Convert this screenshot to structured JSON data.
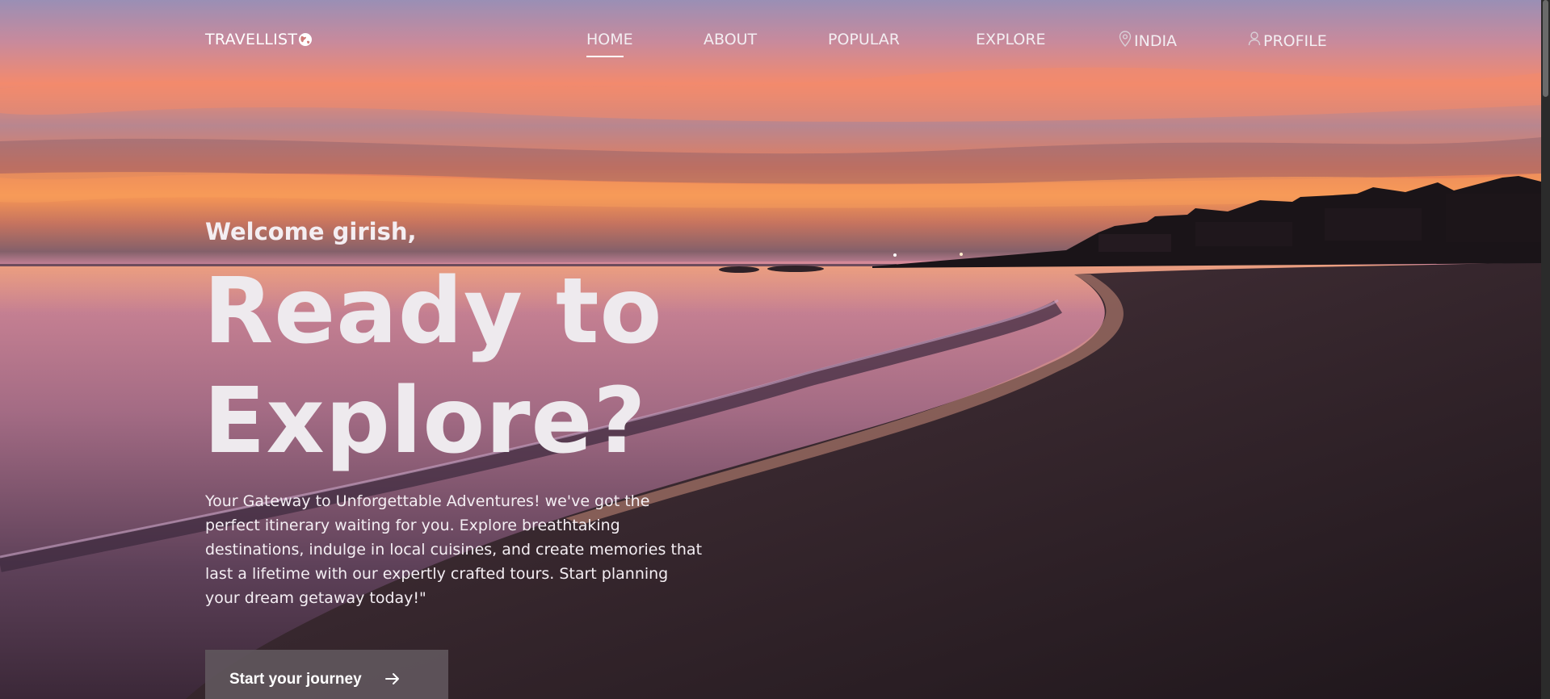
{
  "brand": {
    "name": "TRAVELLIST",
    "icon": "globe-icon"
  },
  "nav": {
    "items": [
      {
        "label": "HOME",
        "active": true
      },
      {
        "label": "ABOUT",
        "active": false
      },
      {
        "label": "POPULAR",
        "active": false
      },
      {
        "label": "EXPLORE",
        "active": false
      },
      {
        "label": "INDIA",
        "icon": "location-pin-icon",
        "active": false
      },
      {
        "label": "PROFILE",
        "icon": "user-icon",
        "active": false
      }
    ]
  },
  "hero": {
    "welcome": "Welcome girish,",
    "headline_line1": "Ready to",
    "headline_line2": "Explore?",
    "description": "Your Gateway to Unforgettable Adventures! we've got the perfect itinerary waiting for you. Explore breathtaking destinations, indulge in local cuisines, and create memories that last a lifetime with our expertly crafted tours. Start planning your dream getaway today!\"",
    "cta_label": "Start your journey",
    "cta_icon": "arrow-right-icon"
  },
  "colors": {
    "accent_text": "#ffffff",
    "cta_bg": "#5f565c",
    "sky_pink": "#f38a6d",
    "sky_orange": "#f79655",
    "sand_dark": "#221820"
  }
}
